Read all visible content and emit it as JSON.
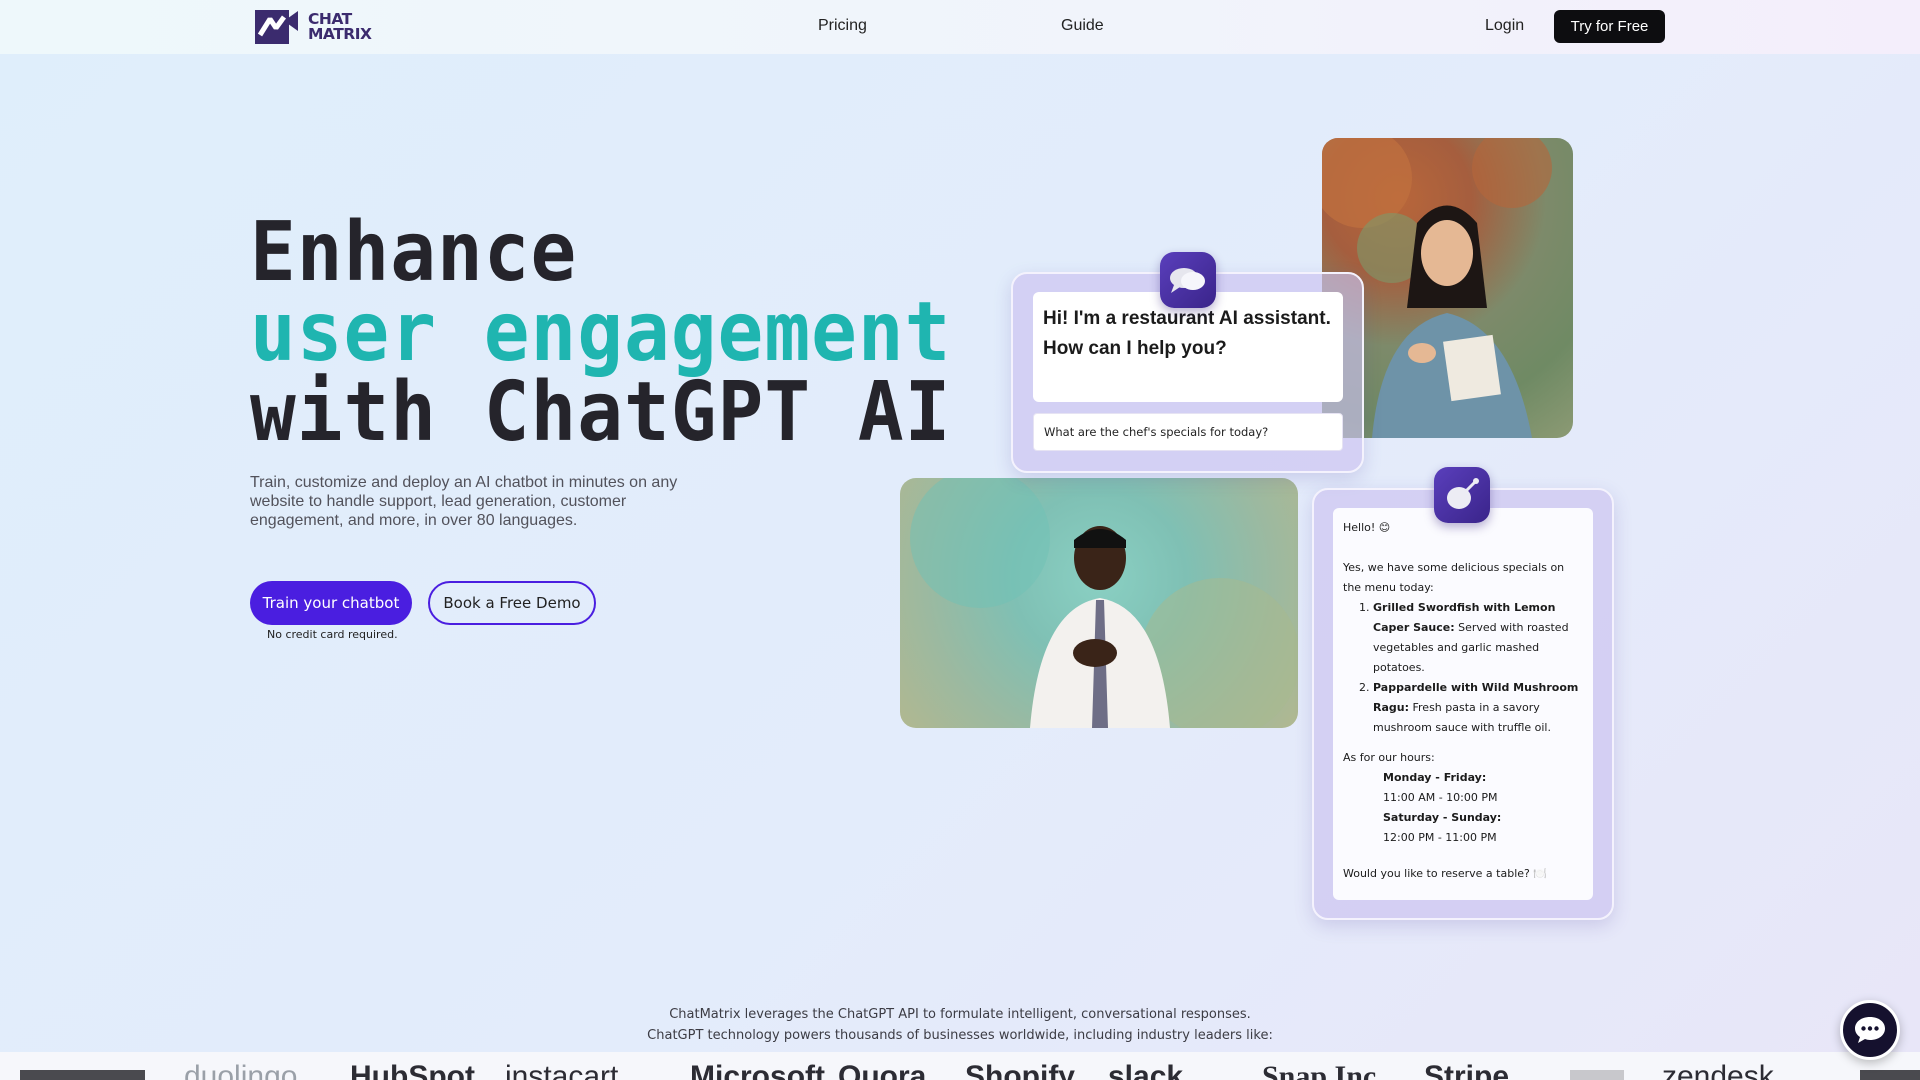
{
  "nav": {
    "logo_line1": "CHAT",
    "logo_line2": "MATRIX",
    "links": [
      "Pricing",
      "Guide"
    ],
    "login": "Login",
    "try_button": "Try for Free"
  },
  "hero": {
    "headline": [
      "Enhance",
      "user engagement",
      "with ChatGPT AI"
    ],
    "headline_accent_color": "#1fb5b0",
    "subtext": "Train, customize and deploy an AI chatbot in minutes on any website to handle support, lead generation, customer engagement, and more, in over 80 languages.",
    "primary_cta": "Train your chatbot",
    "secondary_cta": "Book a Free Demo",
    "cta_note": "No credit card required.",
    "brand_color": "#4a1ee0"
  },
  "chat_demo": {
    "greeting": "Hi! I'm a restaurant AI assistant. How can I help you?",
    "user_question": "What are the chef's specials for today?",
    "reply": {
      "hello": "Hello! 😊",
      "intro": "Yes, we have some delicious specials on the menu today:",
      "specials": [
        {
          "name": "Grilled Swordfish with Lemon Caper Sauce:",
          "desc": " Served with roasted vegetables and garlic mashed potatoes."
        },
        {
          "name": "Pappardelle with Wild Mushroom Ragu:",
          "desc": " Fresh pasta in a savory mushroom sauce with truffle oil."
        }
      ],
      "hours_intro": "As for our hours:",
      "hours": [
        {
          "days": "Monday - Friday:",
          "time": "11:00 AM - 10:00 PM"
        },
        {
          "days": "Saturday - Sunday:",
          "time": "12:00 PM - 11:00 PM"
        }
      ],
      "closing": "Would you like to reserve a table? 🍽️"
    }
  },
  "footer": {
    "line1": "ChatMatrix leverages the ChatGPT API to formulate intelligent, conversational responses.",
    "line2": "ChatGPT technology powers thousands of businesses worldwide, including industry leaders like:",
    "partner_logos": [
      "duolingo",
      "HubSpot",
      "instacart",
      "Microsoft",
      "Quora",
      "Shopify",
      "slack",
      "Snap Inc.",
      "Stripe",
      "zendesk"
    ]
  }
}
